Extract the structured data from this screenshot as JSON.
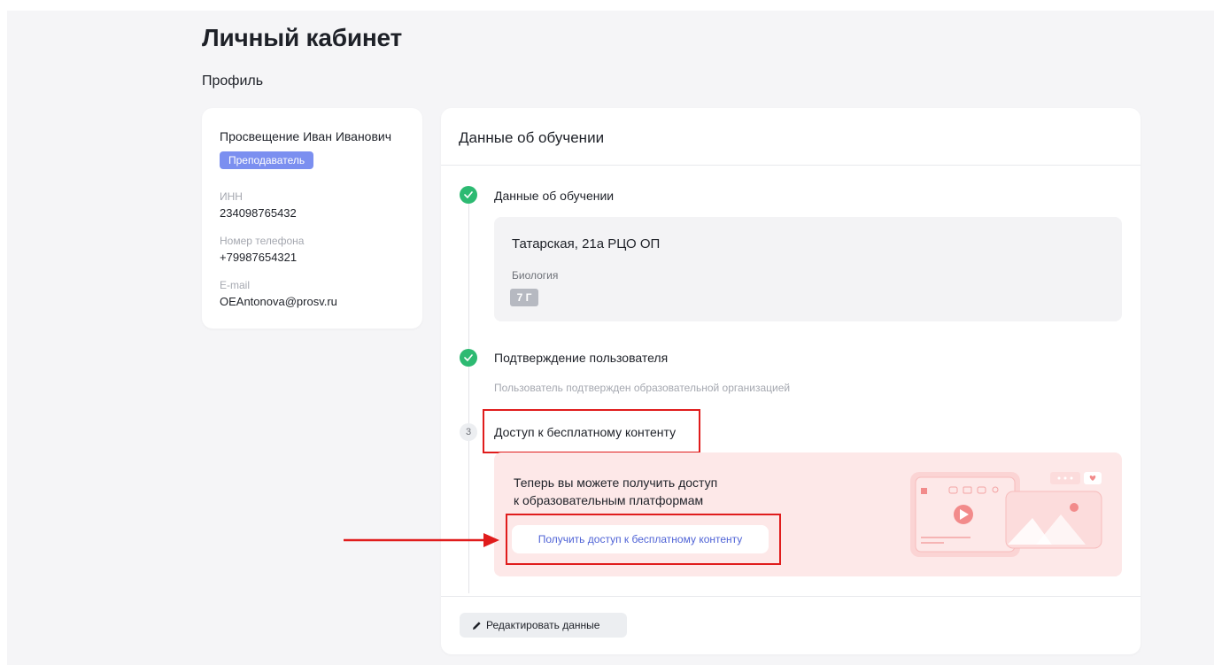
{
  "page": {
    "title": "Личный кабинет",
    "section": "Профиль"
  },
  "profile": {
    "name": "Просвещение Иван Иванович",
    "role": "Преподаватель",
    "fields": [
      {
        "label": "ИНН",
        "value": "234098765432"
      },
      {
        "label": "Номер телефона",
        "value": "+79987654321"
      },
      {
        "label": "E-mail",
        "value": "OEAntonova@prosv.ru"
      }
    ]
  },
  "main": {
    "header": "Данные об обучении",
    "steps": [
      {
        "title": "Данные об обучении",
        "status": "done",
        "organization": "Татарская, 21а РЦО ОП",
        "subject": "Биология",
        "grade": "7 Г"
      },
      {
        "title": "Подтверждение пользователя",
        "status": "done",
        "note": "Пользователь подтвержден образовательной организацией"
      },
      {
        "number": "3",
        "title": "Доступ к бесплатному контенту",
        "status": "current",
        "promo_line1": "Теперь вы можете получить доступ",
        "promo_line2": "к образовательным платформам",
        "button_label": "Получить доступ к бесплатному контенту"
      }
    ],
    "edit_label": "Редактировать данные"
  },
  "colors": {
    "accent": "#4f63d6",
    "badge": "#7b8ff0",
    "success": "#2dba72",
    "highlight": "#e01c1c",
    "promo_bg": "#fde8e8"
  },
  "icons": {
    "step_done": "check-circle-icon",
    "edit": "pencil-icon",
    "annotation": "red-arrow-icon"
  }
}
